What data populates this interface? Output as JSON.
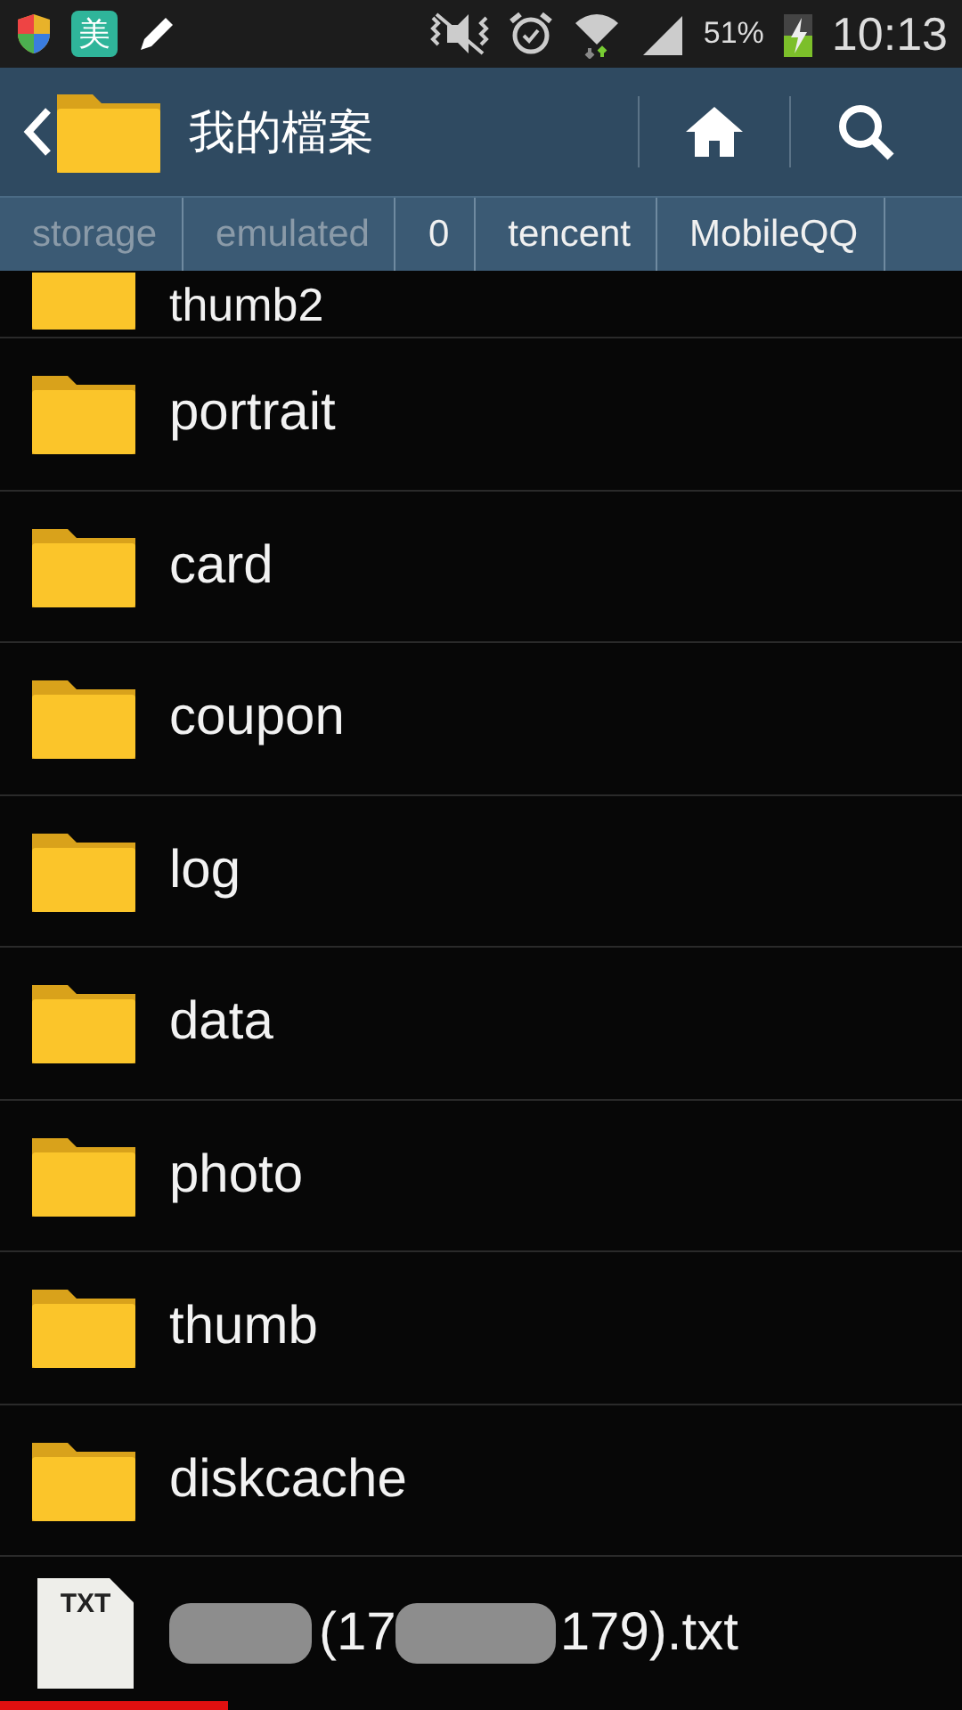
{
  "status_bar": {
    "app_badge": "美",
    "battery": "51%",
    "time": "10:13"
  },
  "header": {
    "title": "我的檔案"
  },
  "breadcrumb": [
    {
      "label": "storage",
      "dimmed": true
    },
    {
      "label": "emulated",
      "dimmed": true
    },
    {
      "label": "0",
      "dimmed": false
    },
    {
      "label": "tencent",
      "dimmed": false
    },
    {
      "label": "MobileQQ",
      "dimmed": false
    }
  ],
  "files": [
    {
      "kind": "folder",
      "name": "thumb2",
      "partial": true
    },
    {
      "kind": "folder",
      "name": "portrait"
    },
    {
      "kind": "folder",
      "name": "card"
    },
    {
      "kind": "folder",
      "name": "coupon"
    },
    {
      "kind": "folder",
      "name": "log"
    },
    {
      "kind": "folder",
      "name": "data"
    },
    {
      "kind": "folder",
      "name": "photo"
    },
    {
      "kind": "folder",
      "name": "thumb"
    },
    {
      "kind": "folder",
      "name": "diskcache"
    },
    {
      "kind": "txt",
      "icon_label": "TXT",
      "name_parts": [
        "(17",
        "179).txt"
      ]
    }
  ]
}
